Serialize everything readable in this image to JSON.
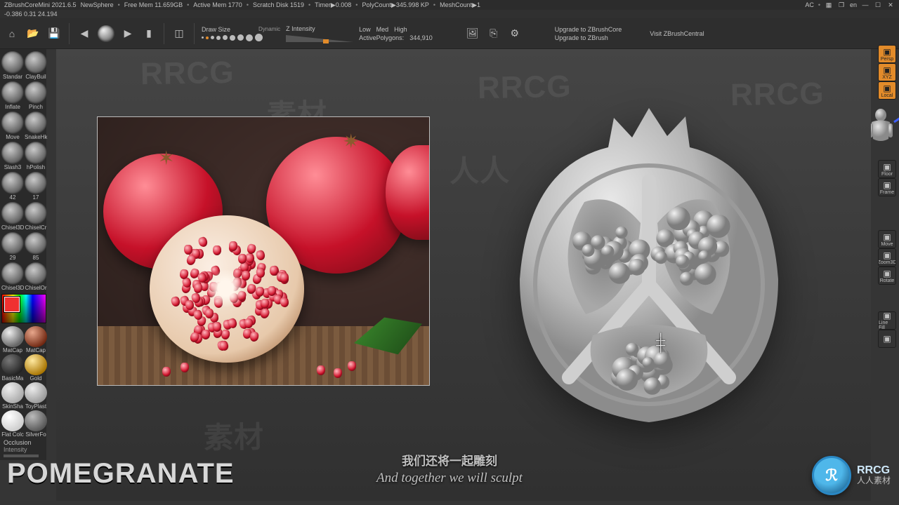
{
  "titlebar": {
    "app": "ZBrushCoreMini 2021.6.5",
    "doc": "NewSphere",
    "free_mem": "Free Mem 11.659GB",
    "active_mem": "Active Mem 1770",
    "scratch": "Scratch Disk 1519",
    "timer": "Timer▶0.008",
    "polycount": "PolyCount▶345.998 KP",
    "meshcount": "MeshCount▶1",
    "lang": "en",
    "ac": "AC"
  },
  "coords": "-0.386 0.31 24.194",
  "toolbar": {
    "draw_size_label": "Draw Size",
    "dynamic_label": "Dynamic",
    "z_intensity_label": "Z Intensity",
    "q_low": "Low",
    "q_med": "Med",
    "q_high": "High",
    "active_polys_label": "ActivePolygons:",
    "active_polys_value": "344,910",
    "link_upgrade_core": "Upgrade to ZBrushCore",
    "link_upgrade_zbrush": "Upgrade to ZBrush",
    "link_visit": "Visit ZBrushCentral"
  },
  "brushes": [
    {
      "label": "Standar"
    },
    {
      "label": "ClayBuil"
    },
    {
      "label": "Inflate"
    },
    {
      "label": "Pinch"
    },
    {
      "label": "Move"
    },
    {
      "label": "SnakeHk"
    },
    {
      "label": "Slash3"
    },
    {
      "label": "hPolish"
    },
    {
      "label": "42"
    },
    {
      "label": "17"
    },
    {
      "label": "Chisel3D"
    },
    {
      "label": "ChiselCr"
    },
    {
      "label": "29"
    },
    {
      "label": "85"
    },
    {
      "label": "Chisel3D"
    },
    {
      "label": "ChiselOr"
    }
  ],
  "materials": [
    {
      "label": "MatCap",
      "cls": "mat-gray"
    },
    {
      "label": "MatCap",
      "cls": "mat-red"
    },
    {
      "label": "BasicMa",
      "cls": "mat-dark"
    },
    {
      "label": "Gold",
      "cls": "mat-gold"
    },
    {
      "label": "SkinSha",
      "cls": "mat-skin"
    },
    {
      "label": "ToyPlast",
      "cls": "mat-toy"
    },
    {
      "label": "Flat Colc",
      "cls": "mat-white"
    },
    {
      "label": "SilverFo",
      "cls": "mat-silver"
    }
  ],
  "left_extras": {
    "occlusion": "Occlusion",
    "intensity": "Intensity"
  },
  "right_buttons": {
    "group1": [
      {
        "label": "Persp",
        "sel": true
      },
      {
        "label": "XYZ",
        "sel": true
      },
      {
        "label": "Local",
        "sel": true
      }
    ],
    "group2": [
      {
        "label": "Floor"
      },
      {
        "label": "Frame"
      }
    ],
    "group3": [
      {
        "label": "Move"
      },
      {
        "label": "Zoom3D"
      },
      {
        "label": "Rotate"
      }
    ],
    "group4": [
      {
        "label": "Line Fill"
      },
      {
        "label": ""
      }
    ]
  },
  "overlay": {
    "title": "POMEGRANATE",
    "sub_cn": "我们还将一起雕刻",
    "sub_en": "And together we will sculpt",
    "logo_text": "RRCG",
    "logo_sub": "人人素材"
  },
  "watermarks": [
    "RRCG",
    "素材",
    "人人",
    "RRCG",
    "素材",
    "RRCG"
  ]
}
